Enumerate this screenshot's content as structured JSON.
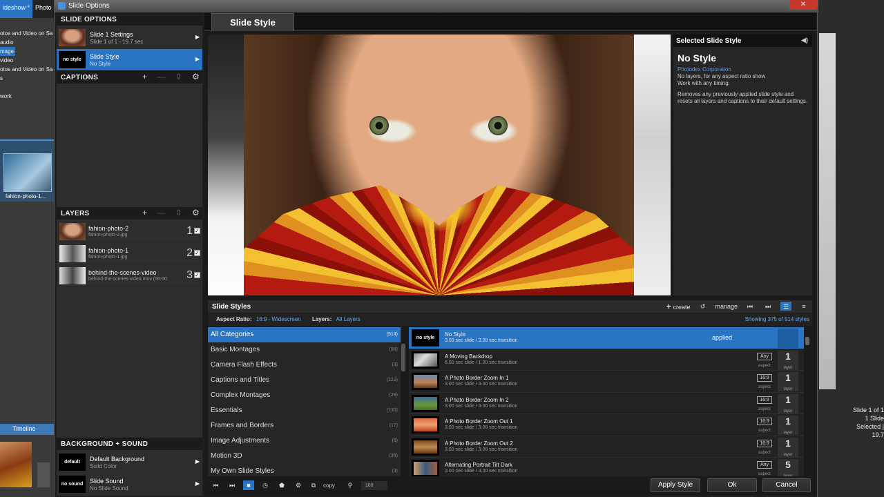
{
  "bg_app": {
    "tabs": [
      {
        "label": "ideshow *"
      },
      {
        "label": "Photo"
      }
    ],
    "tree": [
      "otos and Video on Sa",
      "audio",
      "mage",
      "video",
      "otos and Video on Sa",
      "s",
      "",
      "work"
    ],
    "thumb_label": "fahion-photo-1...",
    "timeline_label": "Timeline",
    "right_count_1": "Slide 1 of 1",
    "right_count_2": "1 Slide Selected | 19.7"
  },
  "window": {
    "title": "Slide Options",
    "close": "✕"
  },
  "slide_options": {
    "header": "SLIDE OPTIONS",
    "items": [
      {
        "title": "Slide 1 Settings",
        "sub": "Slide 1 of 1 - 19.7 sec"
      },
      {
        "title": "Slide Style",
        "sub": "No Style",
        "thumb_text": "no style"
      }
    ]
  },
  "captions": {
    "header": "CAPTIONS"
  },
  "layers": {
    "header": "LAYERS",
    "items": [
      {
        "name": "fahion-photo-2",
        "file": "fahion-photo-2.jpg",
        "num": "1"
      },
      {
        "name": "fahion-photo-1",
        "file": "fahion-photo-1.jpg",
        "num": "2"
      },
      {
        "name": "behind-the-scenes-video",
        "file": "behind-the-scenes-video.mov (00:00:",
        "num": "3"
      }
    ]
  },
  "bg_sound": {
    "header": "BACKGROUND + SOUND",
    "items": [
      {
        "title": "Default Background",
        "sub": "Solid Color",
        "thumb_text": "default"
      },
      {
        "title": "Slide Sound",
        "sub": "No Slide Sound",
        "thumb_text": "no sound"
      }
    ]
  },
  "main": {
    "tab_label": "Slide Style"
  },
  "selected_style": {
    "header": "Selected Slide Style",
    "name": "No Style",
    "corp": "Photodex Corporation",
    "desc1": "No layers, for any aspect ratio show",
    "desc2": "Work with any timing.",
    "desc3": "Removes any previously applied slide style and resets all layers and captions to their default settings."
  },
  "slide_styles": {
    "header": "Slide Styles",
    "create": "create",
    "manage": "manage",
    "aspect_label": "Aspect Ratio:",
    "aspect_value": "16:9 - Widescreen",
    "layers_label": "Layers:",
    "layers_value": "All Layers",
    "showing": "Showing 375 of 514 styles",
    "categories": [
      {
        "name": "All Categories",
        "count": "(514)"
      },
      {
        "name": "Basic Montages",
        "count": "(96)"
      },
      {
        "name": "Camera Flash Effects",
        "count": "(3)"
      },
      {
        "name": "Captions and Titles",
        "count": "(122)"
      },
      {
        "name": "Complex Montages",
        "count": "(28)"
      },
      {
        "name": "Essentials",
        "count": "(130)"
      },
      {
        "name": "Frames and Borders",
        "count": "(17)"
      },
      {
        "name": "Image Adjustments",
        "count": "(6)"
      },
      {
        "name": "Motion 3D",
        "count": "(36)"
      },
      {
        "name": "My Own Slide Styles",
        "count": "(3)"
      }
    ],
    "styles": [
      {
        "name": "No Style",
        "timing": "3.00 sec slide / 3.00 sec transition",
        "status": "applied",
        "thumb_text": "no style"
      },
      {
        "name": "A Moving Backdrop",
        "timing": "6.00 sec slide / 1.00 sec transition",
        "aspect": "Any",
        "layers": "1"
      },
      {
        "name": "A Photo Border Zoom In 1",
        "timing": "3.00 sec slide / 3.00 sec transition",
        "aspect": "16:9",
        "layers": "1"
      },
      {
        "name": "A Photo Border Zoom In 2",
        "timing": "3.00 sec slide / 3.00 sec transition",
        "aspect": "16:9",
        "layers": "1"
      },
      {
        "name": "A Photo Border Zoom Out 1",
        "timing": "3.00 sec slide / 3.00 sec transition",
        "aspect": "16:9",
        "layers": "1"
      },
      {
        "name": "A Photo Border Zoom Out 2",
        "timing": "3.00 sec slide / 3.00 sec transition",
        "aspect": "16:9",
        "layers": "1"
      },
      {
        "name": "Alternating Portrait Tilt Dark",
        "timing": "3.00 sec slide / 3.00 sec transition",
        "aspect": "Any",
        "layers": "5"
      }
    ],
    "aspect_caption": "aspect",
    "layer_caption": "layer"
  },
  "toolbar": {
    "copy": "copy",
    "zoom": "100",
    "apply": "Apply Style",
    "ok": "Ok",
    "cancel": "Cancel"
  }
}
